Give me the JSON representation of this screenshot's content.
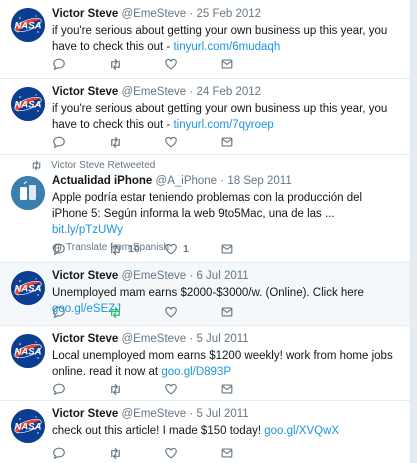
{
  "tweets": [
    {
      "name": "Victor Steve",
      "handle": "@EmeSteve",
      "separator": "·",
      "date": "25 Feb 2012",
      "text": "if you're serious about getting your own business up this year, you have to check this out -",
      "link": "tinyurl.com/6mudaqh",
      "avatar": "nasa-logo"
    },
    {
      "name": "Victor Steve",
      "handle": "@EmeSteve",
      "separator": "·",
      "date": "24 Feb 2012",
      "text": "if you're serious about getting your own business up this year, you have to check this out -",
      "link": "tinyurl.com/7qyroep",
      "avatar": "nasa-logo"
    },
    {
      "retweeted_by": "Victor Steve Retweeted",
      "name": "Actualidad iPhone",
      "handle": "@A_iPhone",
      "separator": "·",
      "date": "18 Sep 2011",
      "text": "Apple podría estar teniendo problemas con la producción del iPhone 5: Según informa la web 9to5Mac, una de las ...",
      "link": "bit.ly/pTzUWy",
      "translate": "Translate from Spanish",
      "retweet_count": "10",
      "like_count": "1",
      "avatar": "actualidad-iphone-logo"
    },
    {
      "name": "Victor Steve",
      "handle": "@EmeSteve",
      "separator": "·",
      "date": "6 Jul 2011",
      "text": "Unemployed mam earns $2000-$3000/w. (Online). Click here",
      "link": "goo.gl/eSEZJ",
      "avatar": "nasa-logo"
    },
    {
      "name": "Victor Steve",
      "handle": "@EmeSteve",
      "separator": "·",
      "date": "5 Jul 2011",
      "text": "Local unemployed mom earns $1200 weekly! work from home jobs online. read it now at",
      "link": "goo.gl/D893P",
      "avatar": "nasa-logo"
    },
    {
      "name": "Victor Steve",
      "handle": "@EmeSteve",
      "separator": "·",
      "date": "5 Jul 2011",
      "text": "check out this article! I made $150 today!",
      "link": "goo.gl/XVQwX",
      "avatar": "nasa-logo"
    }
  ],
  "colors": {
    "link": "#1b95e0",
    "muted": "#657786",
    "retweet_active": "#17bf63",
    "nasa_blue": "#0b3d91",
    "nasa_red": "#fc3d21"
  },
  "icons": [
    "reply-icon",
    "retweet-icon",
    "like-icon",
    "message-icon",
    "globe-icon"
  ]
}
